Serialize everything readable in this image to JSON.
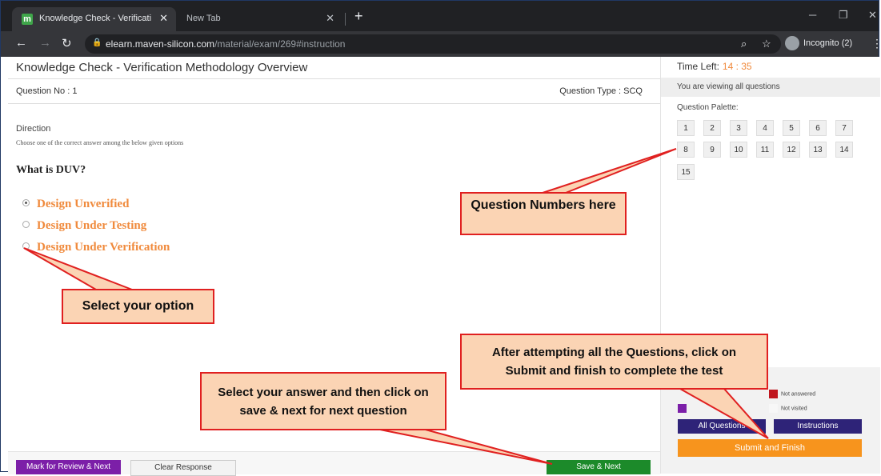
{
  "browser": {
    "active_tab_title": "Knowledge Check - Verification M",
    "second_tab_title": "New Tab",
    "tab_close": "✕",
    "new_tab": "+",
    "url_domain": "elearn.maven-silicon.com",
    "url_path": "/material/exam/269#instruction",
    "incognito_label": "Incognito (2)",
    "favicon_letter": "m"
  },
  "exam": {
    "title": "Knowledge Check - Verification Methodology Overview",
    "question_no": "Question No : 1",
    "question_type": "Question Type : SCQ",
    "direction_label": "Direction",
    "direction_text": "Choose one of the correct answer among the below given options",
    "question": "What is DUV?",
    "options": [
      "Design Unverified",
      "Design Under Testing",
      "Design Under Verification"
    ],
    "selected_option": 0
  },
  "bottom": {
    "mark_label": "Mark for Review & Next",
    "clear_label": "Clear Response",
    "save_label": "Save & Next"
  },
  "side": {
    "time_left_label": "Time Left:",
    "time_left_value": "14 : 35",
    "viewing": "You are viewing all questions",
    "palette_label": "Question Palette:",
    "questions": [
      "1",
      "2",
      "3",
      "4",
      "5",
      "6",
      "7",
      "8",
      "9",
      "10",
      "11",
      "12",
      "13",
      "14",
      "15"
    ],
    "legend_not_answered": "Not answered",
    "legend_not_visited": "Not visited",
    "all_questions_label": "All Questions",
    "instructions_label": "Instructions",
    "submit_label": "Submit and Finish"
  },
  "callouts": {
    "question_numbers": "Question Numbers here",
    "select_option": "Select your option",
    "submit_hint": "After attempting all the Questions, click on Submit and finish to complete the test",
    "save_hint": "Select your  answer and then click on save & next for next question"
  },
  "colors": {
    "accent_orange": "#f08a3c",
    "mark_purple": "#7c1fa8",
    "save_green": "#1c8a2a",
    "submit_orange": "#f7941d",
    "nav_blue": "#2e2378",
    "callout_fill": "#fbd4b4",
    "callout_border": "#e02020"
  }
}
